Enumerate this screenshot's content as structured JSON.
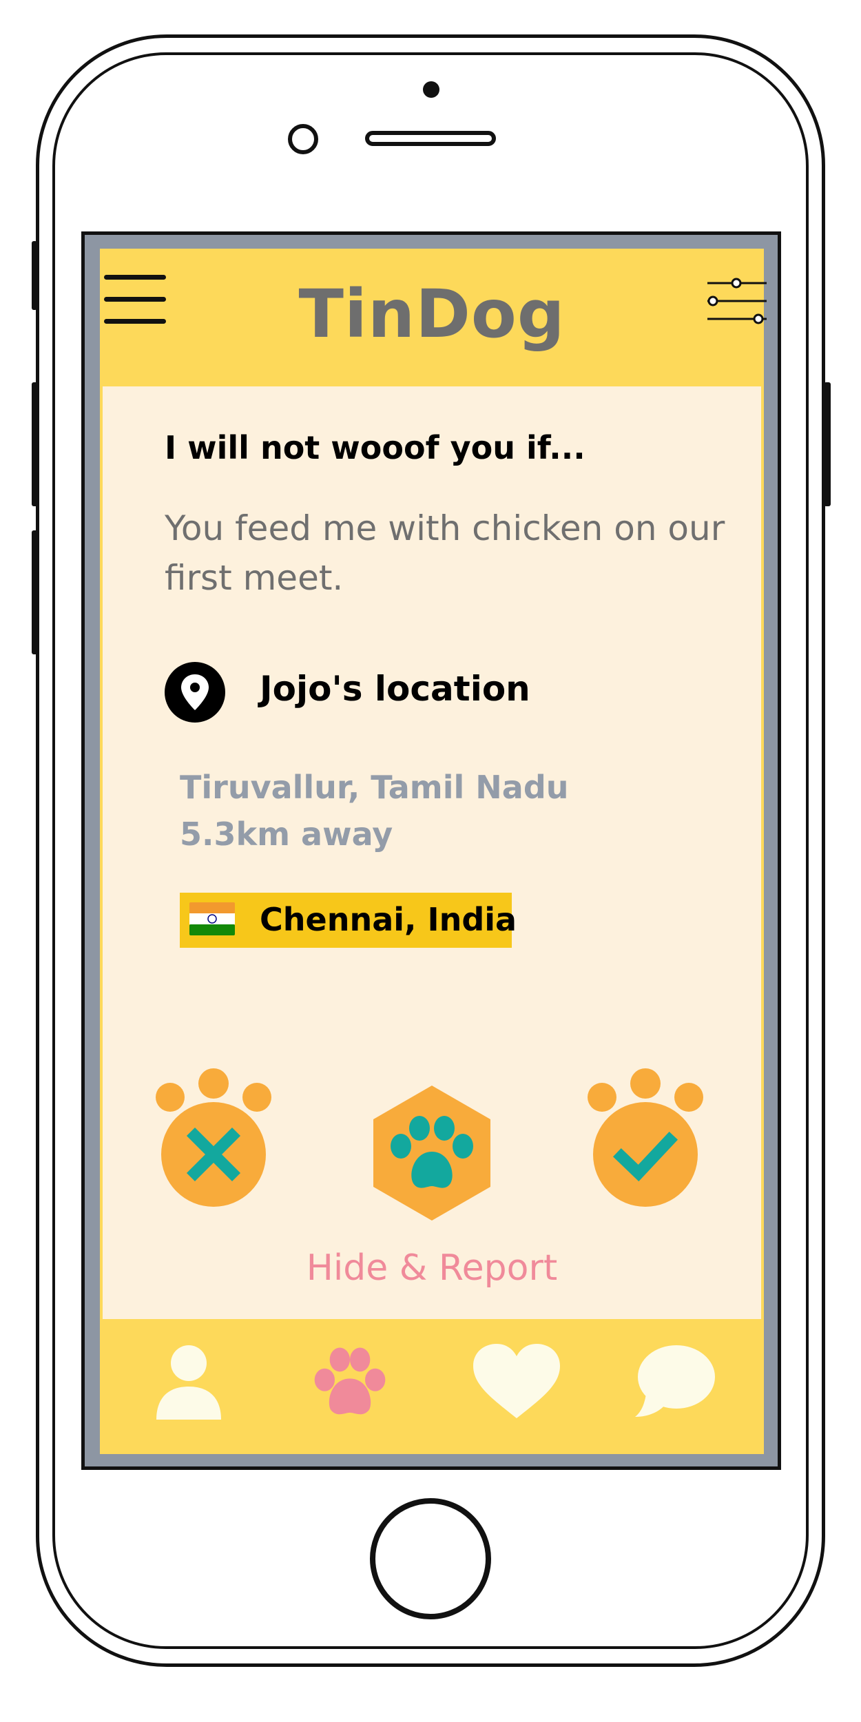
{
  "header": {
    "title": "TinDog",
    "menu_icon": "hamburger-menu-icon",
    "filter_icon": "sliders-icon"
  },
  "card": {
    "prompt_title": "I will not wooof you if...",
    "prompt_text": "You feed me with chicken on our first meet.",
    "location_title": "Jojo's location",
    "location_line1": "Tiruvallur, Tamil Nadu",
    "location_line2": "5.3km away",
    "city_badge": "Chennai, India",
    "flag_icon": "india-flag-icon"
  },
  "actions": {
    "dislike_icon": "paw-x-icon",
    "superlike_icon": "hexagon-paw-icon",
    "like_icon": "paw-check-icon",
    "hide_report": "Hide & Report"
  },
  "bottom_nav": {
    "items": [
      {
        "name": "profile",
        "icon": "user-icon"
      },
      {
        "name": "discover",
        "icon": "paw-icon",
        "active": true
      },
      {
        "name": "likes",
        "icon": "heart-icon"
      },
      {
        "name": "messages",
        "icon": "chat-bubble-icon"
      }
    ]
  },
  "colors": {
    "primary_yellow": "#fdd95a",
    "card_background": "#fdf1dd",
    "orange": "#f8ab3b",
    "teal": "#13a89e",
    "pink": "#f08a9a",
    "muted_text": "#939ca9",
    "brand_text": "#6e6e6e"
  }
}
